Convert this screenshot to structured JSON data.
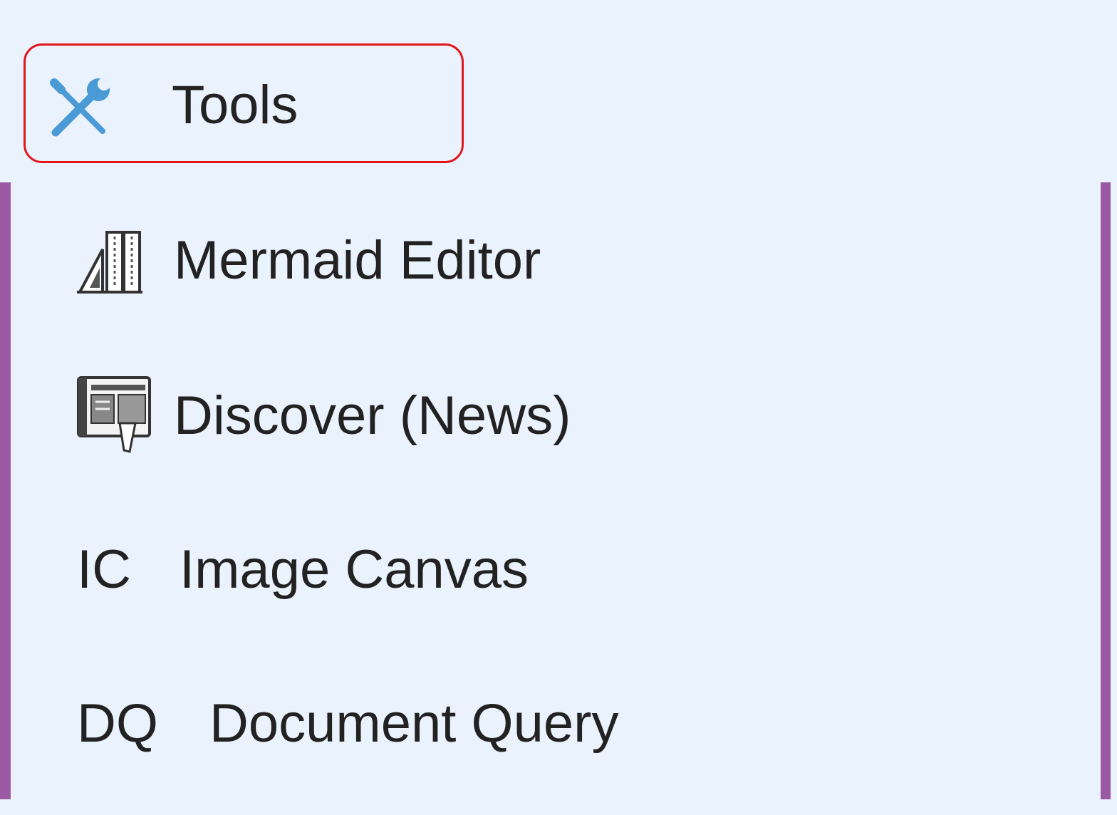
{
  "menu": {
    "header": {
      "label": "Tools",
      "icon": "wrench-screwdriver-icon",
      "icon_color": "#4a9ad6",
      "highlight_color": "#e3151b"
    },
    "accent_color": "#9b59a4",
    "items": [
      {
        "label": "Mermaid Editor",
        "icon": "mermaid-diagram-icon"
      },
      {
        "label": "Discover (News)",
        "icon": "news-discover-icon"
      },
      {
        "abbr": "IC",
        "label": "Image Canvas"
      },
      {
        "abbr": "DQ",
        "label": "Document Query"
      }
    ]
  }
}
